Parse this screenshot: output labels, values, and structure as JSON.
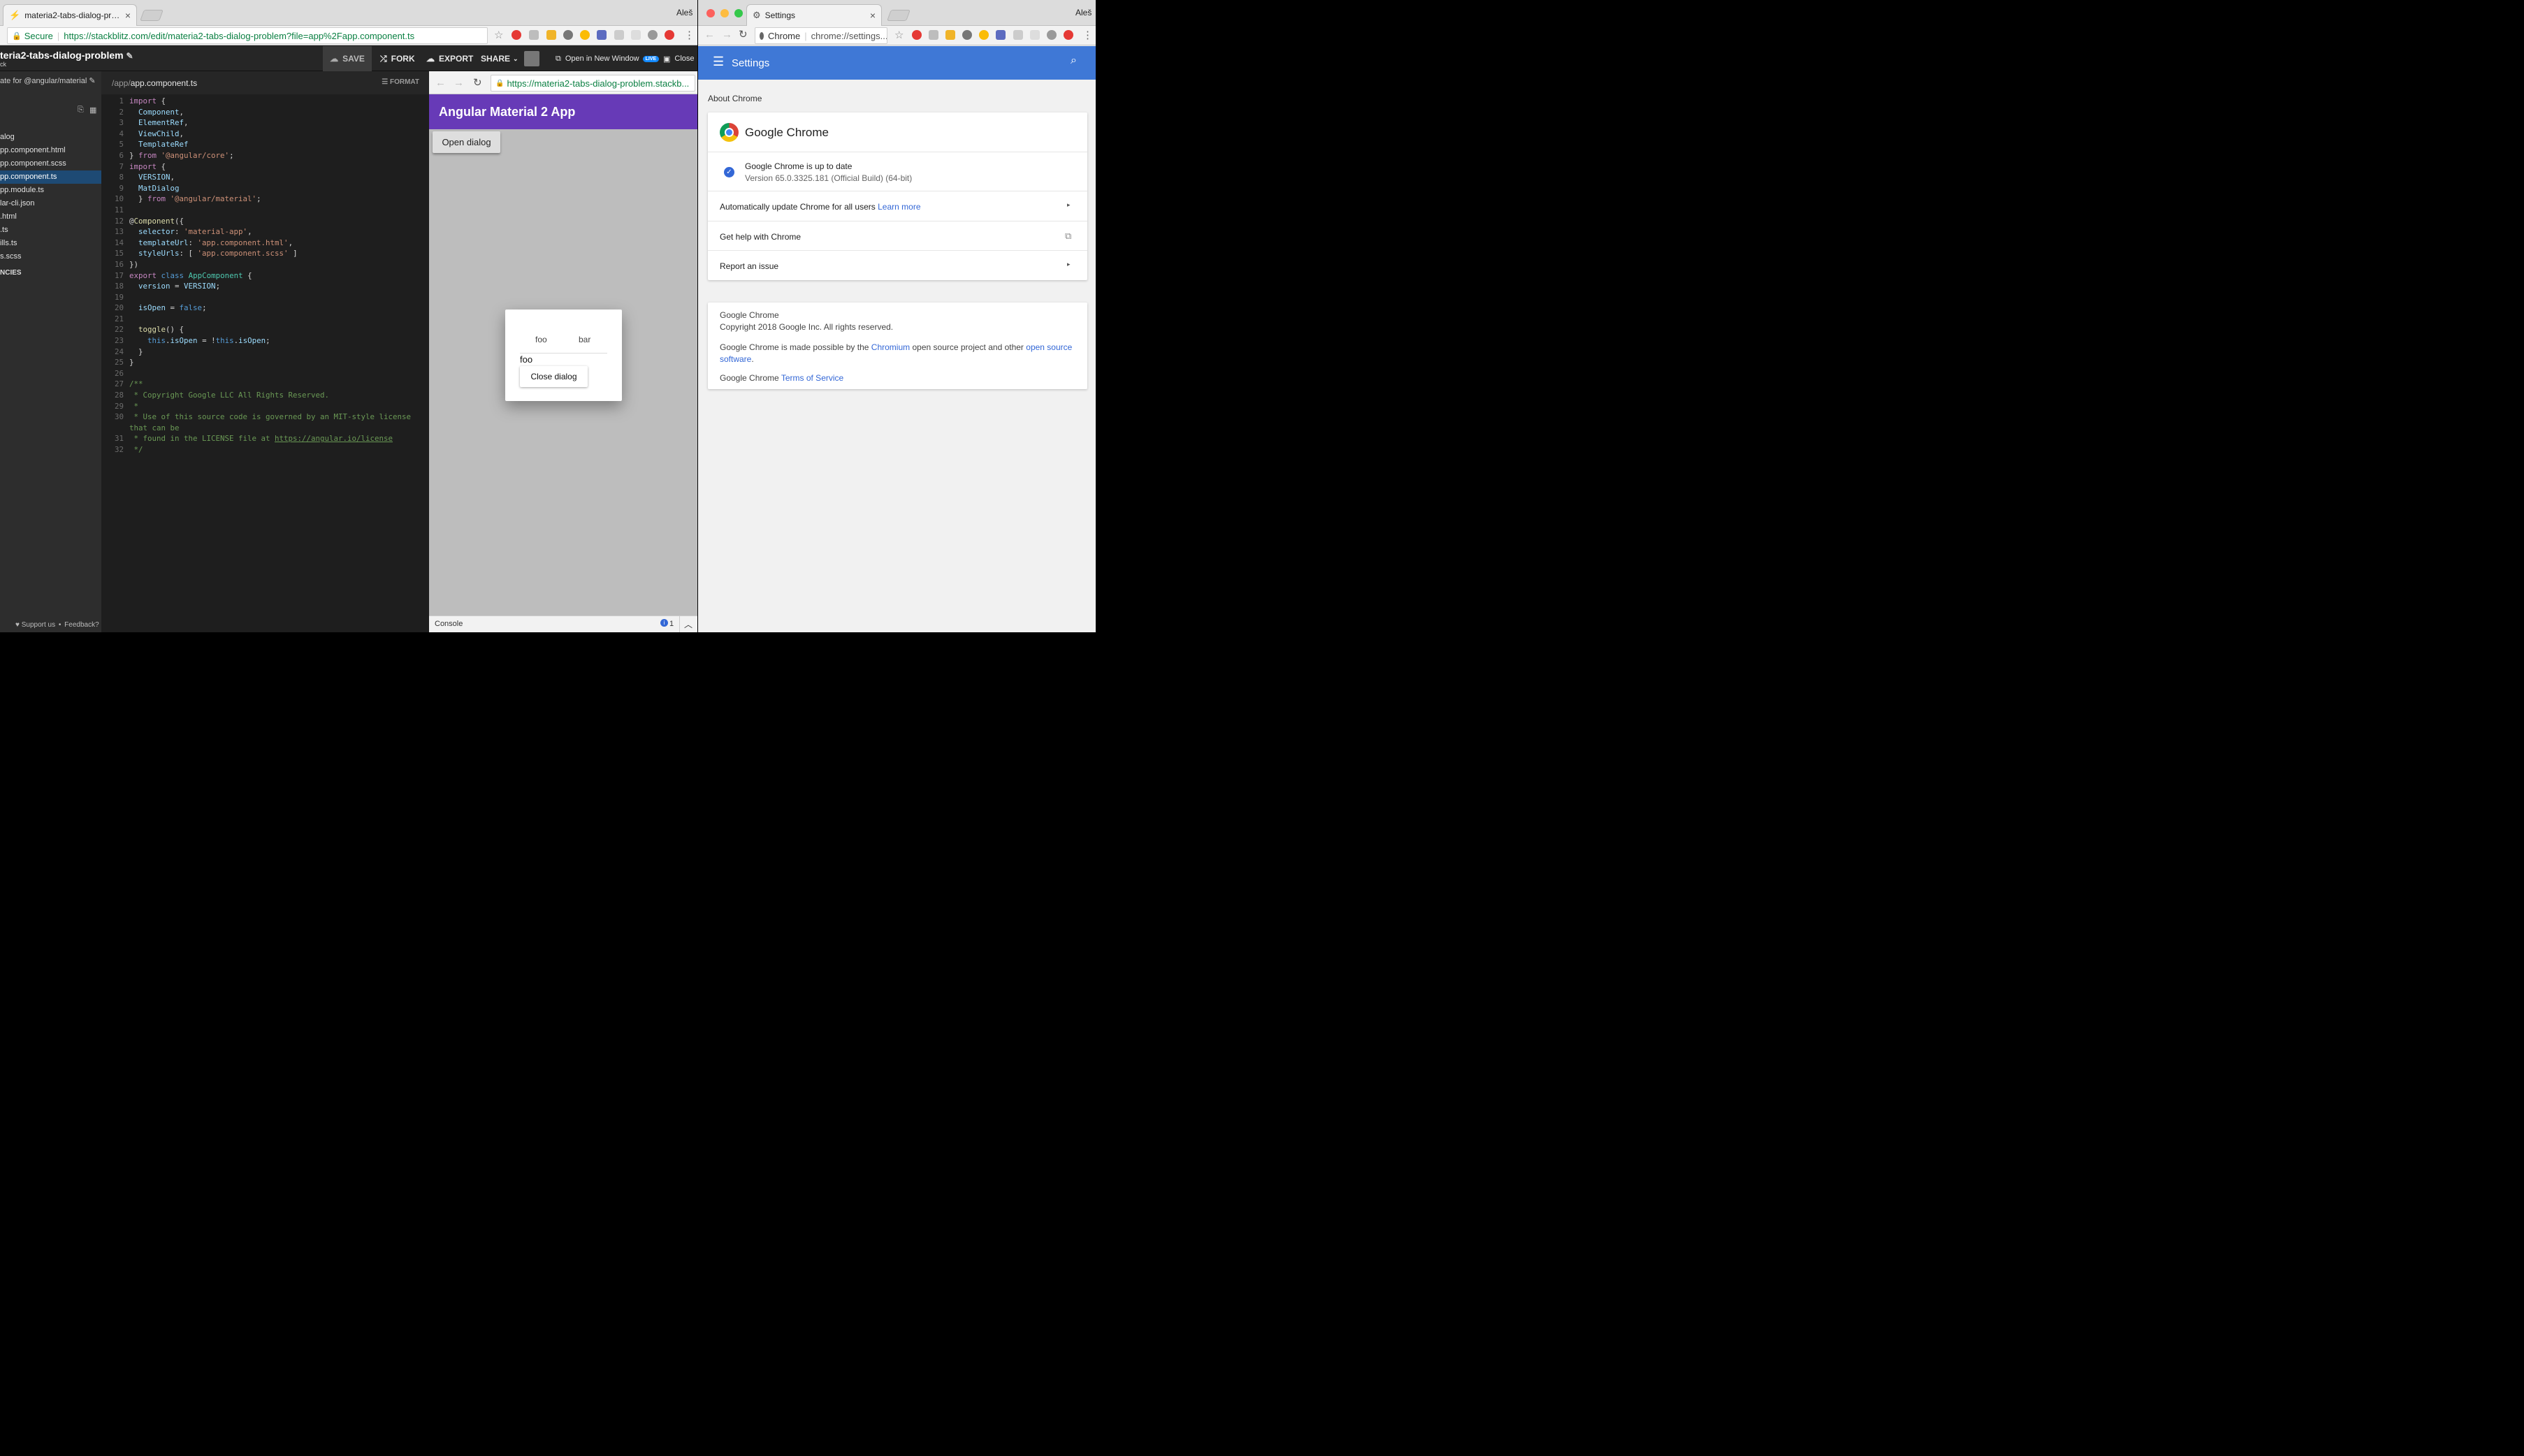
{
  "left": {
    "tab_title": "materia2-tabs-dialog-problem",
    "user_name": "Aleš",
    "secure_label": "Secure",
    "url": "https://stackblitz.com/edit/materia2-tabs-dialog-problem?file=app%2Fapp.component.ts",
    "project_title": "teria2-tabs-dialog-problem",
    "project_sub": "ck",
    "buttons": {
      "save": "SAVE",
      "fork": "FORK",
      "export": "EXPORT",
      "share": "SHARE",
      "open_new_window": "Open in New Window",
      "live_badge": "LIVE",
      "close": "Close"
    },
    "sidebar": {
      "description": "ate for @angular/material",
      "files": [
        "alog",
        "pp.component.html",
        "pp.component.scss",
        "pp.component.ts",
        "pp.module.ts",
        "lar-cli.json",
        ".html",
        ".ts",
        "ills.ts",
        "s.scss"
      ],
      "selected_index": 3,
      "section_label": "NCIES",
      "support": "Support us",
      "feedback": "Feedback?"
    },
    "editor": {
      "path_prefix": "/app/",
      "path_file": "app.component.ts",
      "format": "FORMAT",
      "lines": [
        {
          "n": "1",
          "h": "<span class='k'>import</span> {"
        },
        {
          "n": "2",
          "h": "  <span class='t'>Component</span>,"
        },
        {
          "n": "3",
          "h": "  <span class='t'>ElementRef</span>,"
        },
        {
          "n": "4",
          "h": "  <span class='t'>ViewChild</span>,"
        },
        {
          "n": "5",
          "h": "  <span class='t'>TemplateRef</span>"
        },
        {
          "n": "6",
          "h": "} <span class='k'>from</span> <span class='s'>'@angular/core'</span>;"
        },
        {
          "n": "7",
          "h": "<span class='k'>import</span> {"
        },
        {
          "n": "8",
          "h": "  <span class='t'>VERSION</span>,"
        },
        {
          "n": "9",
          "h": "  <span class='t'>MatDialog</span>"
        },
        {
          "n": "10",
          "h": "  } <span class='k'>from</span> <span class='s'>'@angular/material'</span>;"
        },
        {
          "n": "11",
          "h": ""
        },
        {
          "n": "12",
          "h": "@<span class='f'>Component</span>({"
        },
        {
          "n": "13",
          "h": "  <span class='t'>selector</span>: <span class='s'>'material-app'</span>,"
        },
        {
          "n": "14",
          "h": "  <span class='t'>templateUrl</span>: <span class='s'>'app.component.html'</span>,"
        },
        {
          "n": "15",
          "h": "  <span class='t'>styleUrls</span>: [ <span class='s'>'app.component.scss'</span> ]"
        },
        {
          "n": "16",
          "h": "})"
        },
        {
          "n": "17",
          "h": "<span class='k'>export</span> <span class='kw'>class</span> <span class='cls'>AppComponent</span> {"
        },
        {
          "n": "18",
          "h": "  <span class='t'>version</span> = <span class='t'>VERSION</span>;"
        },
        {
          "n": "19",
          "h": ""
        },
        {
          "n": "20",
          "h": "  <span class='t'>isOpen</span> = <span class='kw'>false</span>;"
        },
        {
          "n": "21",
          "h": ""
        },
        {
          "n": "22",
          "h": "  <span class='f'>toggle</span>() {"
        },
        {
          "n": "23",
          "h": "    <span class='kw'>this</span>.<span class='t'>isOpen</span> = !<span class='kw'>this</span>.<span class='t'>isOpen</span>;"
        },
        {
          "n": "24",
          "h": "  }"
        },
        {
          "n": "25",
          "h": "}"
        },
        {
          "n": "26",
          "h": ""
        },
        {
          "n": "27",
          "h": "<span class='c'>/**</span>"
        },
        {
          "n": "28",
          "h": "<span class='c'> * Copyright Google LLC All Rights Reserved.</span>"
        },
        {
          "n": "29",
          "h": "<span class='c'> *</span>"
        },
        {
          "n": "30",
          "h": "<span class='c'> * Use of this source code is governed by an MIT-style license</span>"
        },
        {
          "n": "",
          "h": "<span class='c'>that can be</span>"
        },
        {
          "n": "31",
          "h": "<span class='c'> * found in the LICENSE file at <u>https://angular.io/license</u></span>"
        },
        {
          "n": "32",
          "h": "<span class='c'> */</span>"
        }
      ]
    },
    "preview": {
      "url": "https://materia2-tabs-dialog-problem.stackb...",
      "app_title": "Angular Material 2 App",
      "open_dialog": "Open dialog",
      "dialog": {
        "tab1": "foo",
        "tab2": "bar",
        "content": "foo",
        "close": "Close dialog"
      },
      "console_label": "Console",
      "console_count": "1"
    }
  },
  "right": {
    "tab_title": "Settings",
    "user_name": "Aleš",
    "omni_chip": "Chrome",
    "omni_url": "chrome://settings...",
    "header_title": "Settings",
    "section_title": "About Chrome",
    "product_name": "Google Chrome",
    "status_title": "Google Chrome is up to date",
    "version": "Version 65.0.3325.181 (Official Build) (64-bit)",
    "auto_update": "Automatically update Chrome for all users",
    "learn_more": "Learn more",
    "help": "Get help with Chrome",
    "report": "Report an issue",
    "about": {
      "name": "Google Chrome",
      "copyright": "Copyright 2018 Google Inc. All rights reserved.",
      "made_pre": "Google Chrome is made possible by the",
      "chromium": "Chromium",
      "made_mid": "open source project and other",
      "oss1": "open source",
      "oss2": "software",
      "tos_pre": "Google Chrome",
      "tos": "Terms of Service"
    }
  },
  "colors": {
    "angular_purple": "#673ab7",
    "settings_blue": "#3f78d6",
    "link_blue": "#3367d6",
    "selected_file": "#1e4a74"
  }
}
